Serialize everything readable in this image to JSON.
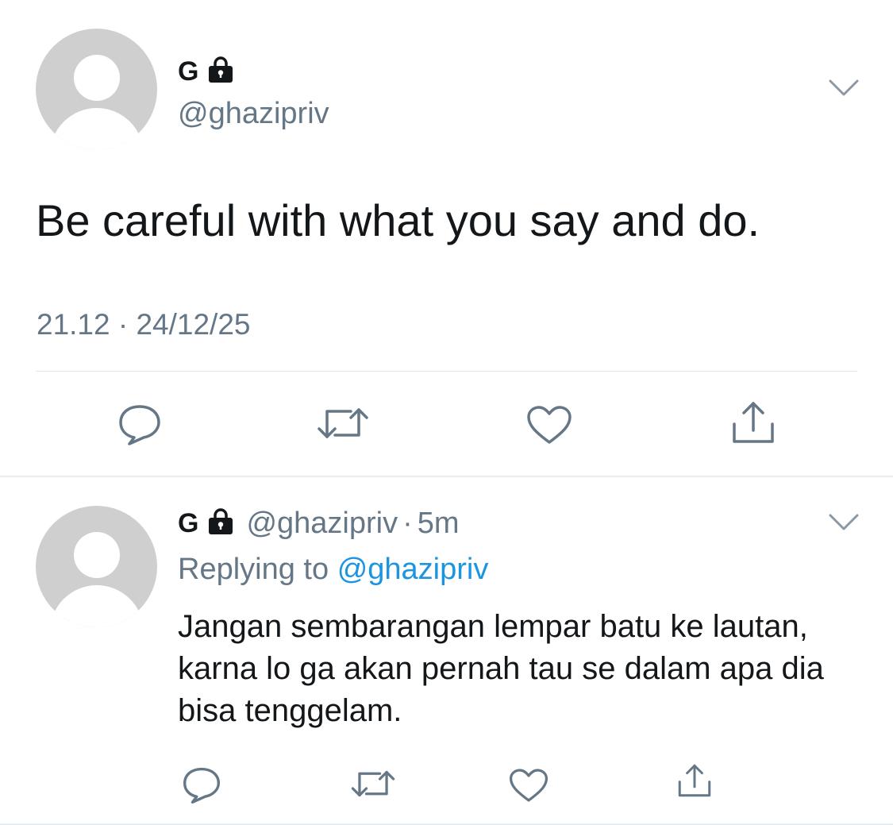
{
  "colors": {
    "text_primary": "#14171a",
    "text_secondary": "#657786",
    "link": "#1b95e0",
    "divider": "#e1e8ed",
    "avatar_placeholder": "#cfcfcf"
  },
  "main_tweet": {
    "display_name": "G",
    "protected_icon": "lock-icon",
    "handle": "@ghazipriv",
    "menu_icon": "chevron-down-icon",
    "text": "Be careful with what you say and do.",
    "timestamp": "21.12 · 24/12/25",
    "actions": {
      "reply_icon": "reply-icon",
      "retweet_icon": "retweet-icon",
      "like_icon": "heart-icon",
      "share_icon": "share-icon"
    }
  },
  "reply_tweet": {
    "display_name": "G",
    "protected_icon": "lock-icon",
    "handle": "@ghazipriv",
    "separator": "·",
    "time": "5m",
    "menu_icon": "chevron-down-icon",
    "replying_to_label": "Replying to",
    "replying_to_handle": "@ghazipriv",
    "text": "Jangan sembarangan lempar batu ke lautan, karna lo ga akan pernah tau se dalam apa dia bisa tenggelam.",
    "actions": {
      "reply_icon": "reply-icon",
      "retweet_icon": "retweet-icon",
      "like_icon": "heart-icon",
      "share_icon": "share-icon"
    }
  }
}
